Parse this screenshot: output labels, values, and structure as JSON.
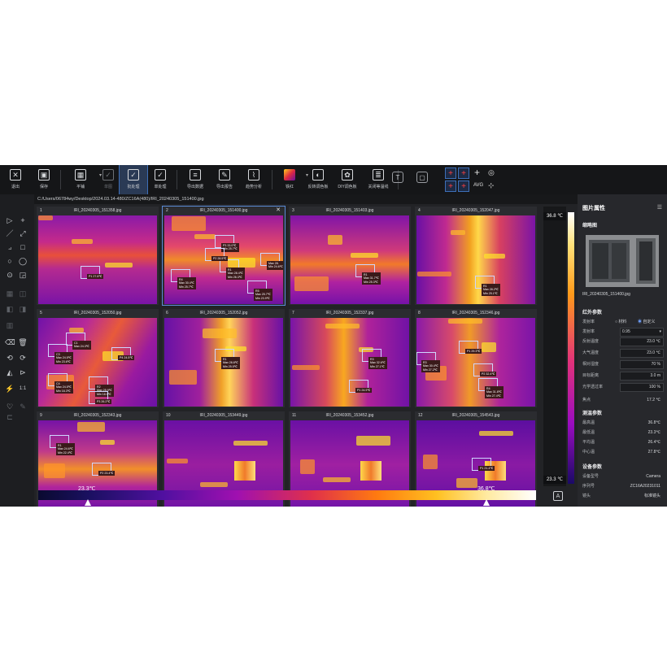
{
  "toolbar": {
    "items": [
      {
        "label": "退出",
        "icon": "close-icon",
        "glyph": "✕"
      },
      {
        "label": "保存",
        "icon": "save-icon",
        "glyph": "▣"
      },
      {
        "label": "平铺",
        "icon": "grid-icon",
        "glyph": "▦"
      },
      {
        "label": "单图",
        "icon": "single-image-icon",
        "glyph": "✓"
      },
      {
        "label": "批处理",
        "icon": "batch-icon",
        "glyph": "✓"
      },
      {
        "label": "单处理",
        "icon": "single-process-icon",
        "glyph": "✓"
      },
      {
        "label": "导出数据",
        "icon": "export-data-icon",
        "glyph": "≡"
      },
      {
        "label": "导出报告",
        "icon": "export-report-icon",
        "glyph": "✎"
      },
      {
        "label": "趋势分析",
        "icon": "trend-icon",
        "glyph": "⌇"
      },
      {
        "label": "铁红",
        "icon": "palette-icon",
        "glyph": ""
      },
      {
        "label": "反转调色板",
        "icon": "invert-palette-icon",
        "glyph": "◐"
      },
      {
        "label": "DIY调色板",
        "icon": "diy-palette-icon",
        "glyph": "✿"
      },
      {
        "label": "关闭等温线",
        "icon": "isotherm-icon",
        "glyph": "≣"
      }
    ],
    "right_icons": [
      "text-icon",
      "box-icon",
      "crosshair-icon",
      "crosshair-icon",
      "crosshair-icon",
      "crosshair-icon",
      "add-point-icon",
      "target-icon"
    ],
    "avg_label": "AVG"
  },
  "path": "C:/Users/06784wy/Desktop/2024.03.14-480/ZC16A(480)/IRI_20240305_151400.jpg",
  "images": [
    {
      "index": "1",
      "name": "IRI_20240305_151358.jpg",
      "tags": [
        "P1 27.8℃"
      ]
    },
    {
      "index": "2",
      "name": "IRI_20240305_151400.jpg",
      "tags": [
        "P3 33.0℃\nMin 25.7℃",
        "R1\nMax 28.4℃\nMin 26.3℃",
        "R4\nMax 30.4℃\nMin 25.7℃",
        "P2 28.5℃",
        "R5\nMax 25.7℃\nMin 23.9℃",
        "Max 28.\nMin 24.6℃"
      ]
    },
    {
      "index": "3",
      "name": "IRI_20240305_151403.jpg",
      "tags": [
        "R1\nMax 31.7℃\nMin 25.3℃"
      ]
    },
    {
      "index": "4",
      "name": "IRI_20240305_152047.jpg",
      "tags": [
        "R1\nMax 28.2℃\nMin 25.1℃"
      ]
    },
    {
      "index": "5",
      "name": "IRI_20240305_152050.jpg",
      "tags": [
        "C1\nMax 24.3℃",
        "C3\nMax 24.5℃\nMin 23.6℃",
        "P4 24.5℃",
        "C4\nMax 24.5℃\nMin 16.3℃",
        "R2\nMax 25.9℃\nMin 18.5℃",
        "P3 26.2℃"
      ]
    },
    {
      "index": "6",
      "name": "IRI_20240305_152052.jpg",
      "tags": [
        "R1\nMax 28.8℃\nMin 25.5℃"
      ]
    },
    {
      "index": "7",
      "name": "IRI_20240305_152337.jpg",
      "tags": [
        "R3\nMax 32.6℃\nMin 27.1℃",
        "P1 24.9℃"
      ]
    },
    {
      "index": "8",
      "name": "IRI_20240305_152346.jpg",
      "tags": [
        "P1 29.3℃",
        "R3\nMax 30.4℃\nMin 27.2℃",
        "P2 32.4℃",
        "R4\nMax 31.8℃\nMin 27.4℃"
      ]
    },
    {
      "index": "9",
      "name": "IRI_20240305_152343.jpg",
      "tags": [
        "R1\nMax 24.6℃\nMin 22.4℃",
        "P2 23.4℃"
      ]
    },
    {
      "index": "10",
      "name": "IRI_20240305_153449.jpg",
      "tags": []
    },
    {
      "index": "11",
      "name": "IRI_20240305_153452.jpg",
      "tags": []
    },
    {
      "index": "12",
      "name": "IRI_20240305_154543.jpg",
      "tags": [
        "P1 21.4℃"
      ]
    }
  ],
  "scale": {
    "max": "36.8 ℃",
    "min": "23.3 ℃",
    "low_marker": "23.3℃",
    "high_marker": "36.8℃",
    "auto_button": "A"
  },
  "panel": {
    "title": "图片属性",
    "thumb_title": "缩略图",
    "thumb_name": "IRI_20240305_151400.jpg",
    "ir_section": "红外参数",
    "emissivity_label": "发射率",
    "radio_material": "材料",
    "radio_custom": "自定义",
    "emissivity_value": "0.95",
    "params": [
      {
        "k": "反射温度",
        "v": "23.0 ℃"
      },
      {
        "k": "大气温度",
        "v": "23.0 ℃"
      },
      {
        "k": "相对湿度",
        "v": "70 %"
      },
      {
        "k": "目标距离",
        "v": "3.0 m"
      },
      {
        "k": "光学透过率",
        "v": "100 %"
      }
    ],
    "focus_label": "焦点",
    "focus_value": "17.2 ℃",
    "measure_section": "测温参数",
    "measure": [
      {
        "k": "最高温",
        "v": "36.8℃"
      },
      {
        "k": "最低温",
        "v": "23.3℃"
      },
      {
        "k": "平均温",
        "v": "26.4℃"
      },
      {
        "k": "中心温",
        "v": "27.8℃"
      }
    ],
    "device_section": "设备参数",
    "device": [
      {
        "k": "设备型号",
        "v": "Camera"
      },
      {
        "k": "序列号",
        "v": "ZC16A20231011"
      },
      {
        "k": "镜头",
        "v": "标准镜头"
      }
    ]
  },
  "colors": {
    "accent": "#3d6fb8",
    "panel": "#27282c",
    "bg": "#222326"
  }
}
